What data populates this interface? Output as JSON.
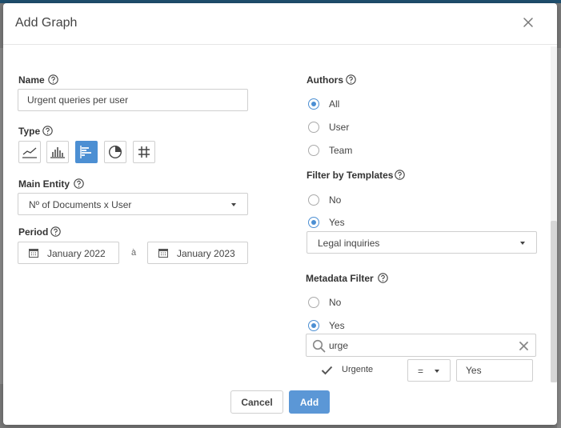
{
  "dialog": {
    "title": "Add Graph",
    "close_icon": "close-icon"
  },
  "name": {
    "label": "Name",
    "value": "Urgent queries per user"
  },
  "type": {
    "label": "Type",
    "options": [
      "line-chart-icon",
      "bar-chart-icon",
      "horizontal-bar-chart-icon",
      "pie-chart-icon",
      "table-grid-icon"
    ],
    "selected": "horizontal-bar-chart-icon"
  },
  "main_entity": {
    "label": "Main Entity",
    "value": "Nº of Documents x User"
  },
  "period": {
    "label": "Period",
    "from": "January 2022",
    "separator": "à",
    "to": "January 2023"
  },
  "authors": {
    "label": "Authors",
    "options": [
      "All",
      "User",
      "Team"
    ],
    "selected": "All"
  },
  "filter_templates": {
    "label": "Filter by Templates",
    "options": [
      "No",
      "Yes"
    ],
    "selected": "Yes",
    "template_value": "Legal inquiries"
  },
  "metadata_filter": {
    "label": "Metadata Filter",
    "options": [
      "No",
      "Yes"
    ],
    "selected": "Yes",
    "search_value": "urge",
    "result": {
      "name": "Urgente",
      "operator": "=",
      "value": "Yes"
    }
  },
  "footer": {
    "cancel_label": "Cancel",
    "add_label": "Add"
  },
  "colors": {
    "accent": "#4c8fd3",
    "primary_button": "#5b97d6",
    "backdrop": "#7a7a7a"
  }
}
